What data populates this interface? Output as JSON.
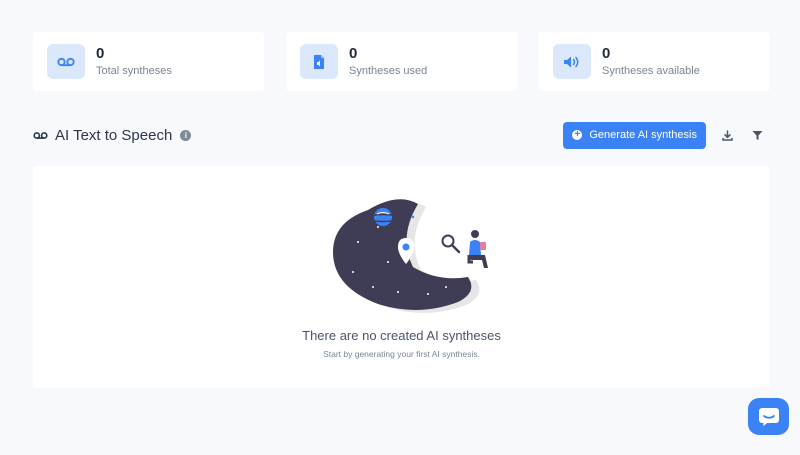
{
  "stats": [
    {
      "value": "0",
      "label": "Total syntheses",
      "icon": "voicemail-icon"
    },
    {
      "value": "0",
      "label": "Syntheses used",
      "icon": "audio-file-icon"
    },
    {
      "value": "0",
      "label": "Syntheses available",
      "icon": "volume-icon"
    }
  ],
  "header": {
    "title": "AI Text to Speech",
    "generate_label": "Generate AI synthesis"
  },
  "empty_state": {
    "title": "There are no created AI syntheses",
    "subtitle": "Start by generating your first AI synthesis."
  },
  "colors": {
    "accent": "#3b82f6",
    "icon_bg": "#dbe8fb",
    "illustration_dark": "#3f3d56"
  }
}
